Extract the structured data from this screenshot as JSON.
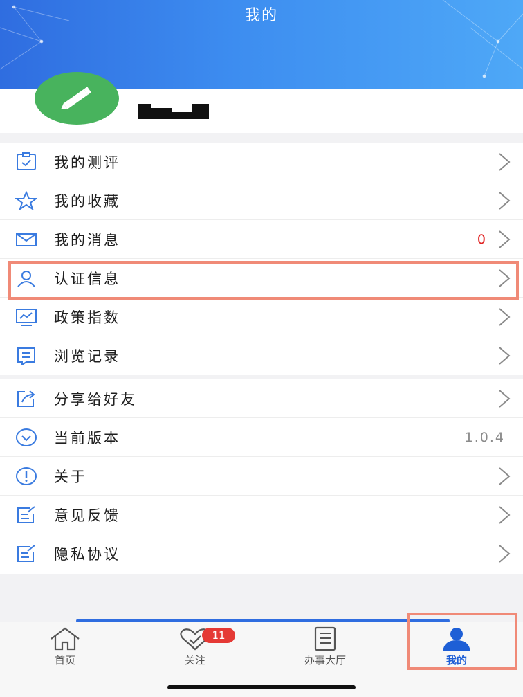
{
  "header": {
    "title": "我的"
  },
  "menu_group1": [
    {
      "label": "我的测评",
      "icon": "clipboard-check-icon"
    },
    {
      "label": "我的收藏",
      "icon": "star-icon"
    },
    {
      "label": "我的消息",
      "icon": "envelope-icon",
      "count": "0"
    },
    {
      "label": "认证信息",
      "icon": "user-icon"
    },
    {
      "label": "政策指数",
      "icon": "chart-monitor-icon"
    },
    {
      "label": "浏览记录",
      "icon": "message-list-icon"
    }
  ],
  "menu_group2": [
    {
      "label": "分享给好友",
      "icon": "share-icon"
    },
    {
      "label": "当前版本",
      "icon": "download-circle-icon",
      "value": "1.0.4"
    },
    {
      "label": "关于",
      "icon": "info-circle-icon"
    },
    {
      "label": "意见反馈",
      "icon": "edit-icon"
    },
    {
      "label": "隐私协议",
      "icon": "edit-icon"
    }
  ],
  "tabbar": [
    {
      "label": "首页",
      "icon": "home-icon"
    },
    {
      "label": "关注",
      "icon": "heart-icon",
      "badge": "11"
    },
    {
      "label": "办事大厅",
      "icon": "document-icon"
    },
    {
      "label": "我的",
      "icon": "person-icon",
      "active": true
    }
  ],
  "colors": {
    "accent": "#2f6de0",
    "avatar": "#48b35d",
    "badge": "#e53935",
    "highlight": "#f08a77"
  }
}
